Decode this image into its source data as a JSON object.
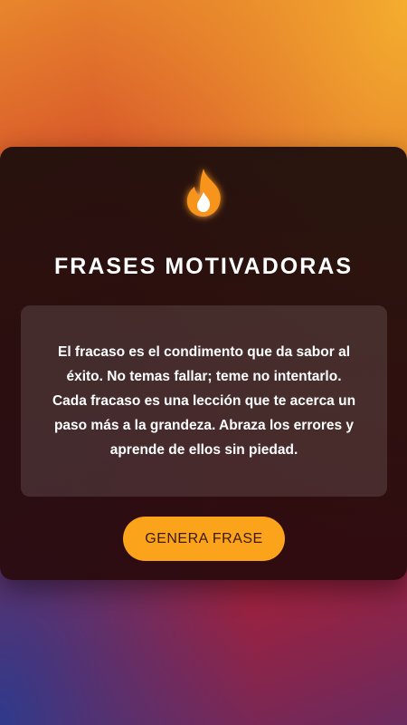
{
  "app": {
    "title": "FRASES MOTIVADORAS",
    "logo_icon": "flame-icon"
  },
  "quote": {
    "text": "El fracaso es el condimento que da sabor al éxito. No temas fallar; teme no intentarlo. Cada fracaso es una lección que te acerca un paso más a la grandeza. Abraza los errores y aprende de ellos sin piedad."
  },
  "actions": {
    "generate_label": "GENERA FRASE"
  },
  "colors": {
    "accent": "#fba31b",
    "flame": "#f7941d",
    "card": "#1c0c0c"
  }
}
